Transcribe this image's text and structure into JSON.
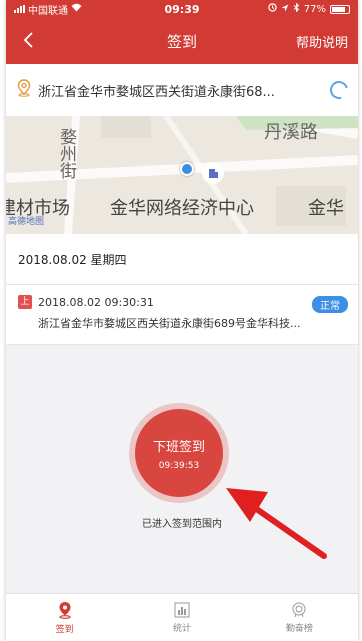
{
  "status_bar": {
    "carrier": "中国联通",
    "time": "09:39",
    "battery": "77%"
  },
  "nav": {
    "title": "签到",
    "help": "帮助说明"
  },
  "location": {
    "address": "浙江省金华市婺城区西关街道永康街68..."
  },
  "map": {
    "labels": {
      "road_top": "丹溪路",
      "street": "婺州街",
      "building_market": "建材市场",
      "center": "金华网络经济中心",
      "right": "金华",
      "watermark": "高德地图"
    }
  },
  "date": "2018.08.02  星期四",
  "record": {
    "tag": "上",
    "time": "2018.08.02 09:30:31",
    "status": "正常",
    "address": "浙江省金华市婺城区西关街道永康街689号金华科技..."
  },
  "checkin": {
    "label": "下班签到",
    "time": "09:39:53",
    "range_text": "已进入签到范围内"
  },
  "tabs": [
    {
      "label": "签到",
      "icon": "location-pin-icon",
      "active": true
    },
    {
      "label": "统计",
      "icon": "chart-icon",
      "active": false
    },
    {
      "label": "勤奋榜",
      "icon": "medal-icon",
      "active": false
    }
  ],
  "colors": {
    "primary": "#d23a34",
    "status_blue": "#3e8ee6"
  }
}
